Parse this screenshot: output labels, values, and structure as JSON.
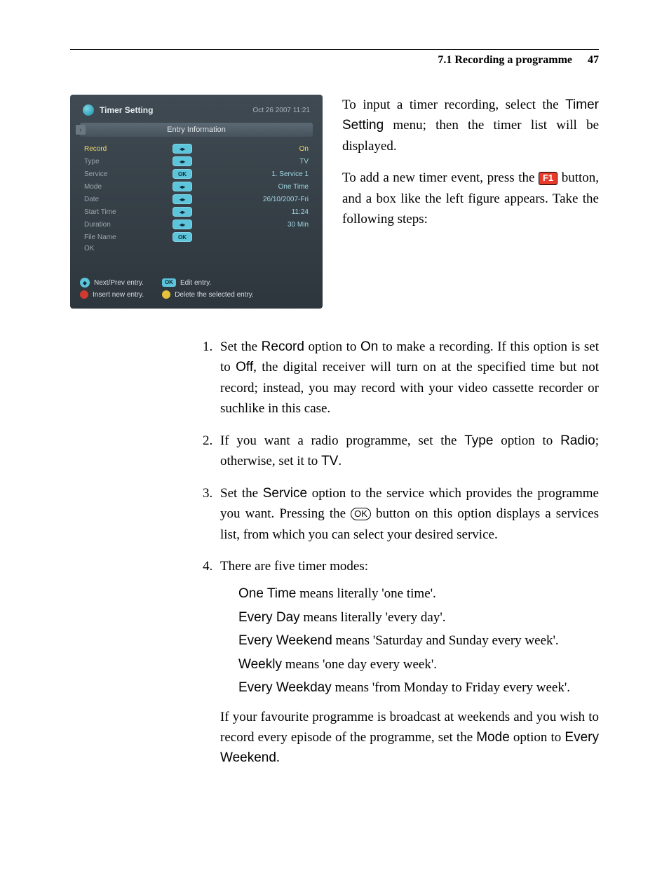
{
  "header": {
    "section": "7.1 Recording a programme",
    "page": "47"
  },
  "osd": {
    "title": "Timer Setting",
    "datetime": "Oct 26 2007 11:21",
    "panel_title": "Entry Information",
    "rows": [
      {
        "label": "Record",
        "mid_kind": "lr",
        "value": "On",
        "hi": true
      },
      {
        "label": "Type",
        "mid_kind": "lr",
        "value": "TV",
        "hi": false
      },
      {
        "label": "Service",
        "mid_kind": "ok",
        "value": "1. Service 1",
        "hi": false
      },
      {
        "label": "Mode",
        "mid_kind": "lr",
        "value": "One Time",
        "hi": false
      },
      {
        "label": "Date",
        "mid_kind": "lr",
        "value": "26/10/2007-Fri",
        "hi": false
      },
      {
        "label": "Start Time",
        "mid_kind": "lr",
        "value": "11:24",
        "hi": false
      },
      {
        "label": "Duration",
        "mid_kind": "lr",
        "value": "30 Min",
        "hi": false
      },
      {
        "label": "File Name",
        "mid_kind": "ok",
        "value": "",
        "hi": false
      },
      {
        "label": "OK",
        "mid_kind": "",
        "value": "",
        "hi": false
      }
    ],
    "legend": {
      "l1a": "Next/Prev entry.",
      "l1b": "Edit entry.",
      "l2a": "Insert new entry.",
      "l2b": "Delete the selected entry."
    },
    "pill_lr": "◂▸",
    "pill_ok": "OK"
  },
  "intro": {
    "p1a": "To input a timer recording, select the ",
    "p1b": "Timer Setting",
    "p1c": " menu; then the timer list will be displayed.",
    "p2a": "To add a new timer event, press the ",
    "p2b": " button, and a box like the left figure appears. Take the following steps:",
    "f1": "F1"
  },
  "steps": {
    "s1": {
      "a": "Set the ",
      "b": "Record",
      "c": " option to ",
      "d": "On",
      "e": " to make a recording. If this option is set to ",
      "f": "Off",
      "g": ", the digital receiver will turn on at the specified time but not record; instead, you may record with your video cassette recorder or suchlike in this case."
    },
    "s2": {
      "a": "If you want a radio programme, set the ",
      "b": "Type",
      "c": " option to ",
      "d": "Radio",
      "e": "; otherwise, set it to ",
      "f": "TV",
      "g": "."
    },
    "s3": {
      "a": "Set the ",
      "b": "Service",
      "c": " option to the service which provides the programme you want. Pressing the ",
      "ok": "OK",
      "d": " button on this option displays a services list, from which you can select your desired service."
    },
    "s4": {
      "lead": "There are five timer modes:",
      "modes": [
        {
          "name": "One Time",
          "desc": " means literally 'one time'."
        },
        {
          "name": "Every Day",
          "desc": " means literally 'every day'."
        },
        {
          "name": "Every Weekend",
          "desc": " means 'Saturday and Sunday every week'."
        },
        {
          "name": "Weekly",
          "desc": " means 'one day every week'."
        },
        {
          "name": "Every Weekday",
          "desc": " means 'from Monday to Friday every week'."
        }
      ],
      "after_a": "If your favourite programme is broadcast at weekends and you wish to record every episode of the programme, set the ",
      "after_b": "Mode",
      "after_c": " option to ",
      "after_d": "Every Weekend",
      "after_e": "."
    }
  }
}
